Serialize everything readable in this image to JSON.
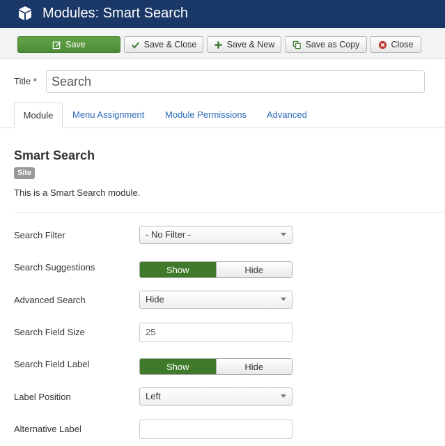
{
  "header": {
    "title": "Modules: Smart Search",
    "logo_icon": "joomla-cube-icon",
    "bg_color": "#1a3867"
  },
  "toolbar": {
    "save": "Save",
    "save_close": "Save & Close",
    "save_new": "Save & New",
    "save_copy": "Save as Copy",
    "close": "Close"
  },
  "form": {
    "title_label": "Title *",
    "title_value": "Search"
  },
  "tabs": [
    {
      "label": "Module"
    },
    {
      "label": "Menu Assignment"
    },
    {
      "label": "Module Permissions"
    },
    {
      "label": "Advanced"
    }
  ],
  "module": {
    "name": "Smart Search",
    "badge": "Site",
    "description": "This is a Smart Search module."
  },
  "fields": {
    "search_filter": {
      "label": "Search Filter",
      "value": "- No Filter -"
    },
    "search_suggestions": {
      "label": "Search Suggestions",
      "on": "Show",
      "off": "Hide"
    },
    "advanced_search": {
      "label": "Advanced Search",
      "value": "Hide"
    },
    "search_field_size": {
      "label": "Search Field Size",
      "value": "25"
    },
    "search_field_label": {
      "label": "Search Field Label",
      "on": "Show",
      "off": "Hide"
    },
    "label_position": {
      "label": "Label Position",
      "value": "Left"
    },
    "alternative_label": {
      "label": "Alternative Label",
      "value": ""
    }
  },
  "colors": {
    "accent_green": "#4d8b36",
    "link_blue": "#2a69b8"
  }
}
